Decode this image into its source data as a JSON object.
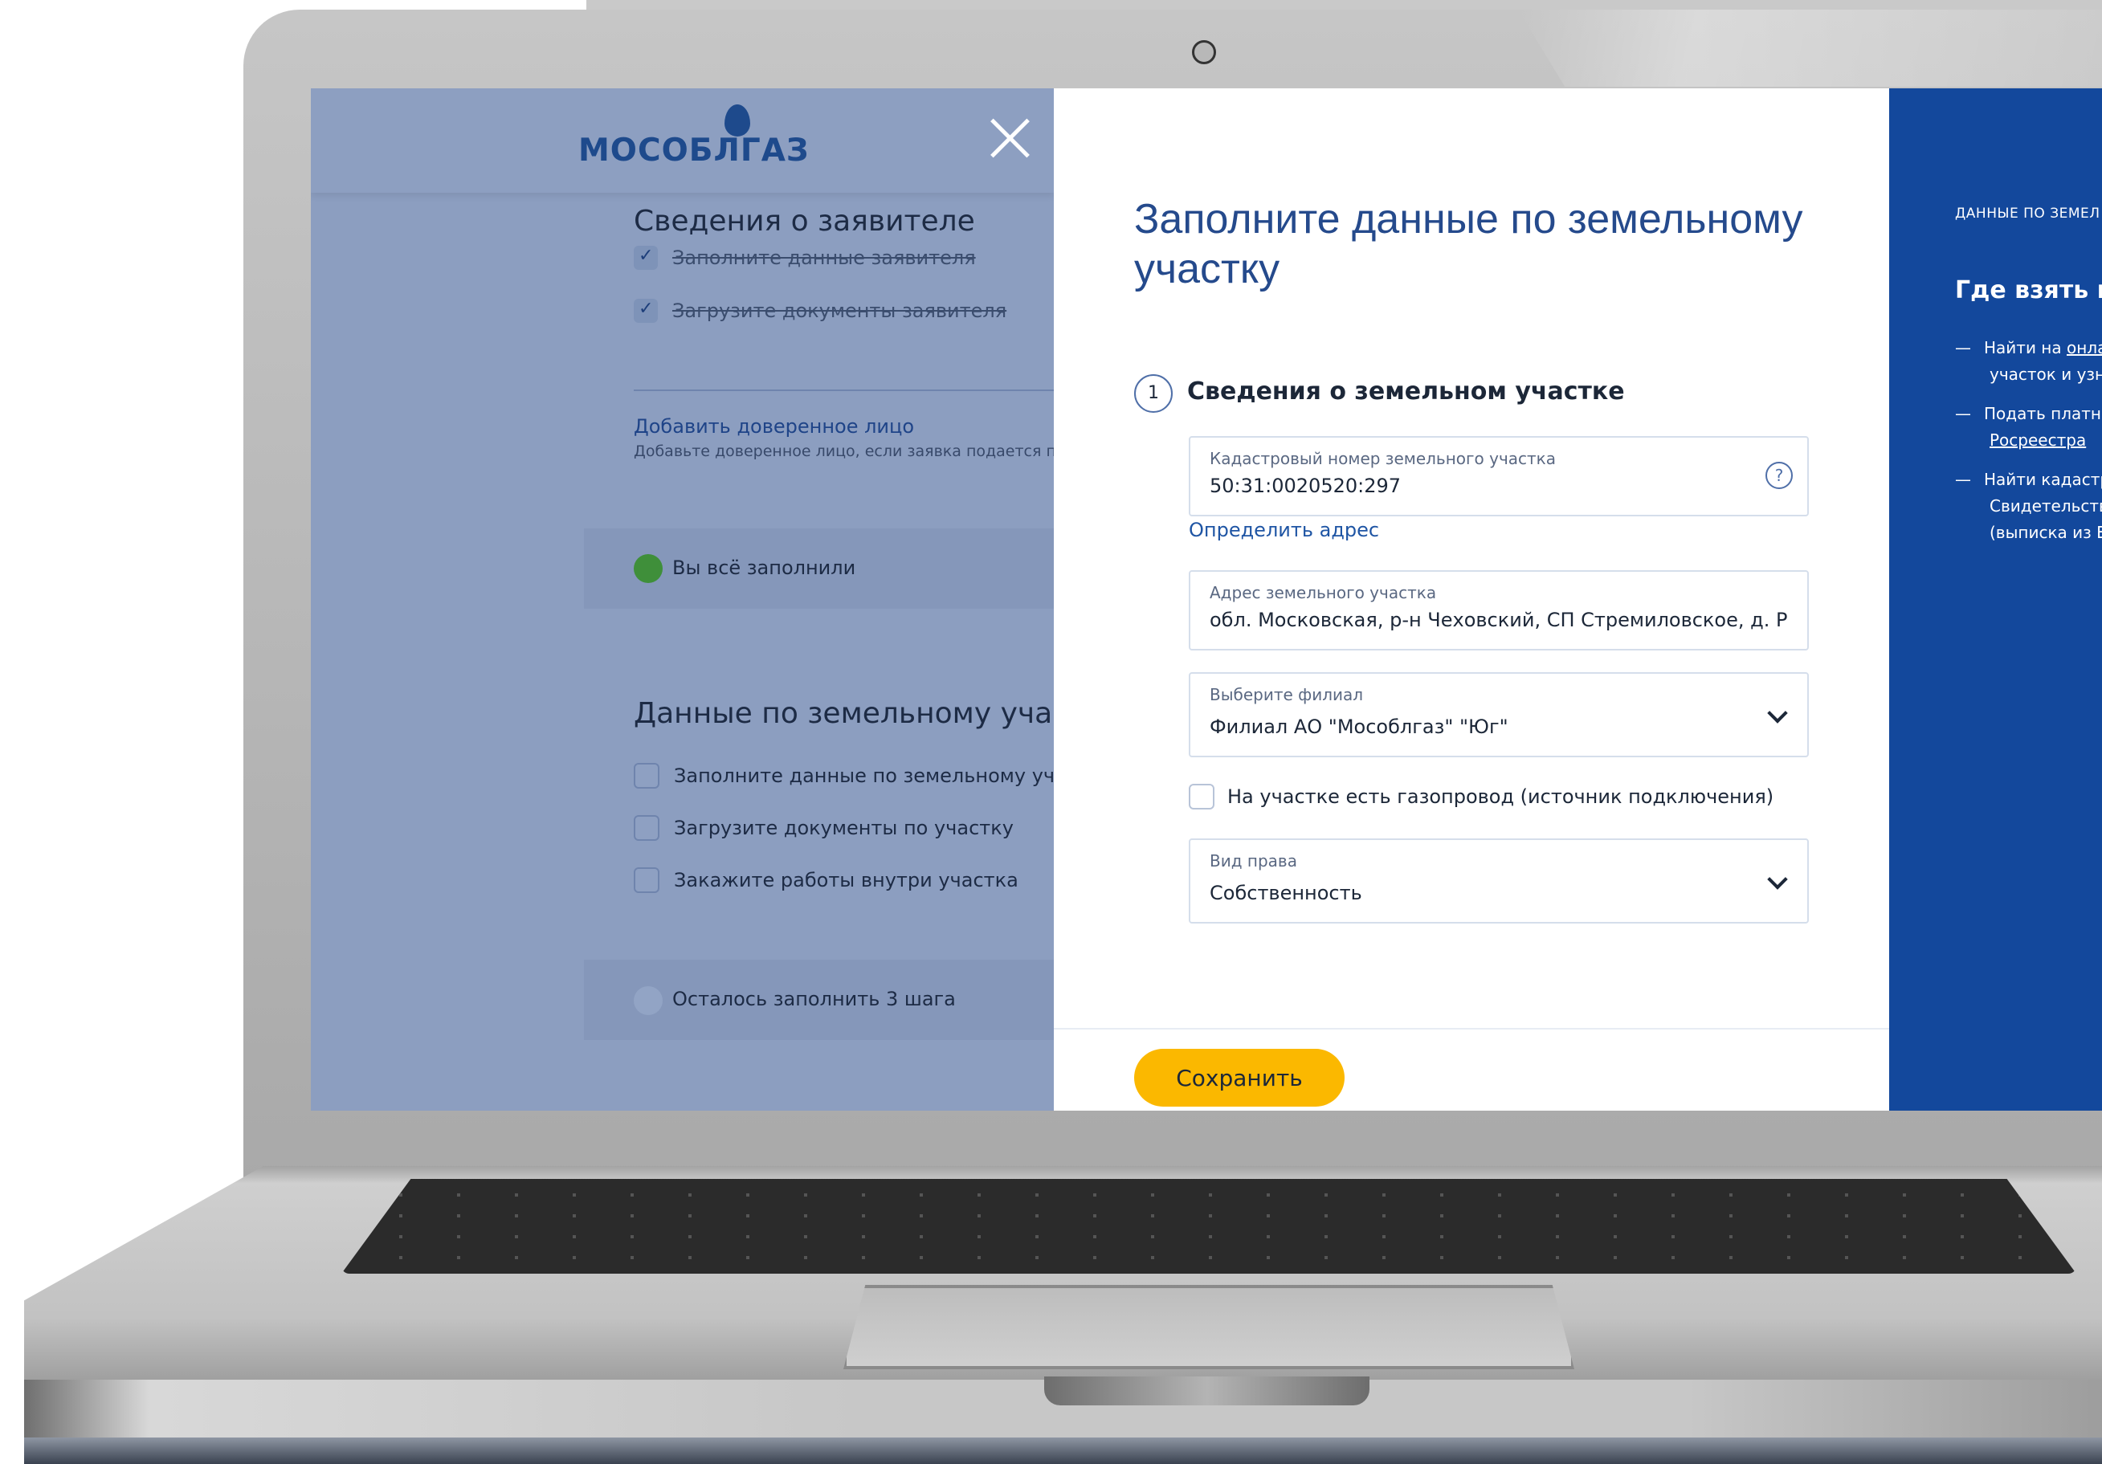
{
  "background_page": {
    "logo_text": "МОСОБЛГАЗ",
    "applicant_section": {
      "heading": "Сведения о заявителе",
      "done_items": [
        "Заполните данные заявителя",
        "Загрузите документы заявителя"
      ],
      "trusted_person_link": "Добавить доверенное лицо",
      "trusted_person_hint": "Добавьте доверенное лицо, если заявка подается п",
      "status": "Вы всё заполнили"
    },
    "land_section": {
      "heading": "Данные по земельному участ",
      "items": [
        "Заполните данные по земельному участк",
        "Загрузите документы по участку",
        "Закажите работы внутри участка"
      ],
      "status": "Осталось заполнить 3 шага"
    }
  },
  "modal": {
    "title": "Заполните данные по земельному участку",
    "step": {
      "number": "1",
      "title": "Сведения о земельном участке"
    },
    "cadastral": {
      "label": "Кадастровый номер земельного участка",
      "value": "50:31:0020520:297",
      "help": "?"
    },
    "detect_address_link": "Определить адрес",
    "address": {
      "label": "Адрес земельного участка",
      "value": "обл. Московская, р-н Чеховский, СП Стремиловское, д. Репник"
    },
    "branch": {
      "label": "Выберите филиал",
      "value": "Филиал АО \"Мособлгаз\" \"Юг\""
    },
    "gas_pipeline_checkbox": {
      "label": "На участке есть газопровод (источник подключения)",
      "checked": false
    },
    "right_type": {
      "label": "Вид права",
      "value": "Собственность"
    },
    "save_label": "Сохранить"
  },
  "side_panel": {
    "caption": "ДАННЫЕ ПО ЗЕМЕЛ",
    "title": "Где взять ка",
    "items": [
      {
        "dash": "—",
        "text_plain": "Найти на ",
        "text_link": "онла",
        "line2": "участок и узна",
        "line2_link": ""
      },
      {
        "dash": "—",
        "text_plain": "Подать платны",
        "text_link": "",
        "line2": "",
        "line2_link": "Росреестра"
      },
      {
        "dash": "—",
        "text_plain": "Найти кадастр",
        "text_link": "",
        "line2": "Свидетельстве",
        "line3": "(выписка из ЕГ"
      }
    ]
  },
  "colors": {
    "brand_blue": "#13489c",
    "title_blue": "#254a8c",
    "link_blue": "#1f55a4",
    "save_yellow": "#fbb800",
    "overlay": "#8c9ec0",
    "success_green": "#3f8f3a"
  },
  "icons": {
    "close": "close-icon",
    "help": "help-icon",
    "dropdown": "chevron-down-icon",
    "check": "check-icon",
    "logo_flame": "flame-icon",
    "camera": "camera-icon"
  }
}
